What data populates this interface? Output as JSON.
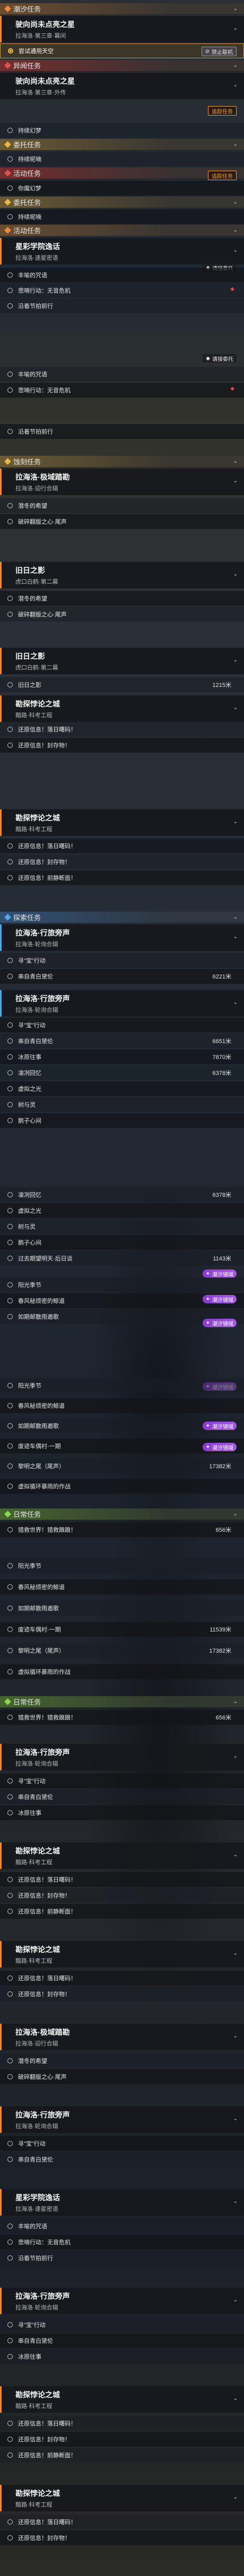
{
  "sections": {
    "trend": "潮汐任务",
    "rumor": "异闻任务",
    "commission": "委托任务",
    "activity": "活动任务",
    "stalk": "追踪任务",
    "main": "主线任务",
    "hunt": "蚀刻任务",
    "explore": "探索任务",
    "daily": "日常任务"
  },
  "badges": {
    "forbid": "禁止联机",
    "track": "追踪任务",
    "unlock": "请接委托",
    "mirage": "潮汐镜域"
  },
  "chevron": "⌄",
  "pin": "◆",
  "quests": {
    "q1": {
      "title": "驶向尚未点亮之星",
      "sub": "拉海洛·第三章·幕间"
    },
    "q1_obj": "尝试通用天空",
    "q2": {
      "title": "驶向尚未点亮之星",
      "sub": "拉海洛·第三章·外传"
    },
    "q3_obj": "持续幻梦",
    "q4_obj": "持续呢喃",
    "q5_obj": "你魔幻梦",
    "q6": {
      "title": "星彩学院逸话",
      "sub": "拉海洛·速星密语"
    },
    "q6_objs": [
      "丰喻的咒语",
      "悲喃行动：无音危机",
      "沿着节拍前行"
    ],
    "q6b_objs": [
      "丰喻的咒语",
      "悲喃行动：无音危机",
      "沿着节拍前行"
    ],
    "q7": {
      "title": "拉海洛·极域踏勘",
      "sub": "拉海洛·迎行合辑"
    },
    "q7_objs": [
      "潜冬的希望",
      "破碎翻版之心·尾声"
    ],
    "q8": {
      "title": "旧日之影",
      "sub": "虎口白鹤·第二幕"
    },
    "q8_objs": [
      "潜冬的希望",
      "破碎翻版之心·尾声"
    ],
    "q9": {
      "title": "旧日之影",
      "sub": "虎口白鹤·第二幕"
    },
    "q9_obj": "旧日之影",
    "q9_dist": "1215米",
    "q10": {
      "title": "勘探悖论之城",
      "sub": "黯路·科考工程"
    },
    "q10_objs": [
      "还原信息！落日曙码！",
      "还原信息！封存物！"
    ],
    "q11": {
      "title": "勘探悖论之城",
      "sub": "黯路·科考工程"
    },
    "q11_objs": [
      "还原信息！落日曙码！",
      "还原信息！封存物！",
      "还原信息！前静断面！"
    ],
    "q12": {
      "title": "拉海洛·行旅旁声",
      "sub": "拉海洛·轮询合辑"
    },
    "q12_objs": [
      [
        "寻\"宝\"行动",
        ""
      ],
      [
        "串自青白黛伦",
        "6221米"
      ]
    ],
    "q13": {
      "title": "拉海洛·行旅旁声",
      "sub": "拉海洛·轮询合辑"
    },
    "q13_objs": [
      [
        "寻\"宝\"行动",
        ""
      ],
      [
        "串自青白黛伦",
        "6651米"
      ],
      [
        "冰原往事",
        "7870米"
      ],
      [
        "凛冽回忆",
        "6378米"
      ],
      [
        "虚拟之光",
        ""
      ],
      [
        "树与灵",
        ""
      ],
      [
        "鹅子心间",
        ""
      ]
    ],
    "q14_objs": [
      [
        "凛冽回忆",
        "6378米"
      ],
      [
        "虚拟之光",
        ""
      ],
      [
        "树与灵",
        ""
      ],
      [
        "鹅子心间",
        ""
      ],
      [
        "过去期望明天·后日谈",
        "1143米"
      ]
    ],
    "q15_objs": [
      [
        "阳光季节",
        ""
      ],
      [
        "春风秘烦密的鲸道",
        ""
      ],
      [
        "如期邮散雨邀歌",
        ""
      ]
    ],
    "q16_objs": [
      [
        "阳光季节",
        ""
      ],
      [
        "春风秘烦密的鲸道",
        ""
      ],
      [
        "如期邮散雨邀歌",
        ""
      ],
      [
        "废迹车偶村·一期",
        "11539米"
      ],
      [
        "黎明之尾（尾声）",
        "17382米"
      ],
      [
        "虚拟循环暴雨的作战",
        ""
      ]
    ],
    "q17_obj": "猎救世界！猎救踉踉！",
    "q17_dist": "656米",
    "q18_objs": [
      [
        "阳光季节",
        ""
      ],
      [
        "春风秘烦密的鲸道",
        ""
      ],
      [
        "如期邮散雨邀歌",
        ""
      ],
      [
        "废迹车偶村·一期",
        "11539米"
      ],
      [
        "黎明之尾（尾声）",
        "17382米"
      ],
      [
        "虚拟循环暴雨的作战",
        ""
      ]
    ],
    "q19_obj": "猎救世界！猎救踉踉！",
    "q19_dist": "656米"
  }
}
